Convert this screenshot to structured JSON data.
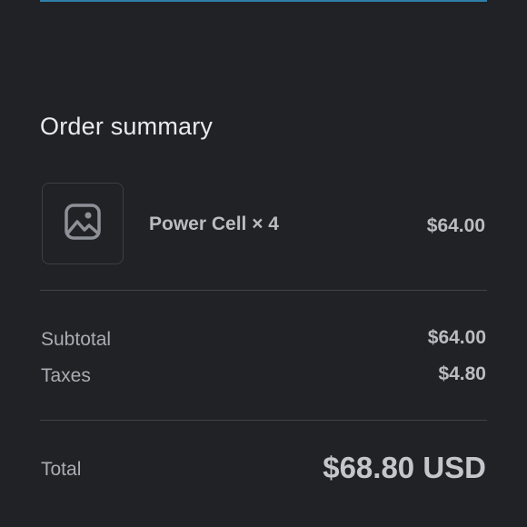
{
  "order_summary": {
    "title": "Order summary",
    "items": [
      {
        "name": "Power Cell × 4",
        "price": "$64.00",
        "thumbnail_icon": "image-placeholder-icon"
      }
    ],
    "subtotal": {
      "label": "Subtotal",
      "value": "$64.00"
    },
    "taxes": {
      "label": "Taxes",
      "value": "$4.80"
    },
    "total": {
      "label": "Total",
      "value": "$68.80 USD"
    }
  },
  "colors": {
    "background": "#202226",
    "accent_strip": "#2f7fa8",
    "divider": "#3f4247",
    "primary_text": "#e9eaec",
    "secondary_text": "#a9adb3"
  }
}
